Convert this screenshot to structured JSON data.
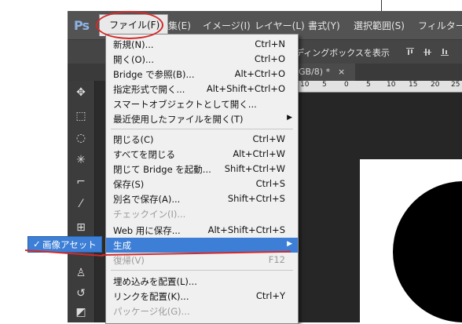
{
  "app": {
    "logo": "Ps",
    "menu": [
      {
        "label": "ファイル(F)"
      },
      {
        "label": "編集(E)"
      },
      {
        "label": "イメージ(I)"
      },
      {
        "label": "レイヤー(L)"
      },
      {
        "label": "書式(Y)"
      },
      {
        "label": "選択範囲(S)"
      },
      {
        "label": "フィルター(T"
      }
    ],
    "options_text": "ディングボックスを表示",
    "doc_tab": "GB/8) *",
    "doc_close": "×",
    "ruler_labels": [
      "10",
      "5",
      "0",
      "5",
      "10",
      "15",
      "20",
      "25"
    ]
  },
  "file_menu": {
    "items": [
      {
        "label": "新規(N)...",
        "shortcut": "Ctrl+N"
      },
      {
        "label": "開く(O)...",
        "shortcut": "Ctrl+O"
      },
      {
        "label": "Bridge で参照(B)...",
        "shortcut": "Alt+Ctrl+O"
      },
      {
        "label": "指定形式で開く...",
        "shortcut": "Alt+Shift+Ctrl+O"
      },
      {
        "label": "スマートオブジェクトとして開く...",
        "shortcut": ""
      },
      {
        "label": "最近使用したファイルを開く(T)",
        "shortcut": "",
        "submenu": true
      },
      {
        "label": "閉じる(C)",
        "shortcut": "Ctrl+W"
      },
      {
        "label": "すべてを閉じる",
        "shortcut": "Alt+Ctrl+W"
      },
      {
        "label": "閉じて Bridge を起動...",
        "shortcut": "Shift+Ctrl+W"
      },
      {
        "label": "保存(S)",
        "shortcut": "Ctrl+S"
      },
      {
        "label": "別名で保存(A)...",
        "shortcut": "Shift+Ctrl+S"
      },
      {
        "label": "チェックイン(I)...",
        "shortcut": "",
        "disabled": true
      },
      {
        "label": "Web 用に保存...",
        "shortcut": "Alt+Shift+Ctrl+S"
      },
      {
        "label": "生成",
        "shortcut": "",
        "submenu": true,
        "highlighted": true
      },
      {
        "label": "復帰(V)",
        "shortcut": "F12",
        "disabled": true
      },
      {
        "label": "埋め込みを配置(L)...",
        "shortcut": ""
      },
      {
        "label": "リンクを配置(K)...",
        "shortcut": "Ctrl+Y"
      },
      {
        "label": "パッケージ化(G)...",
        "shortcut": "",
        "disabled": true
      }
    ],
    "submenu_arrow": "▶"
  },
  "generate_submenu": {
    "check": "✓",
    "label": "画像アセット"
  },
  "colors": {
    "highlight": "#3d7fd6",
    "annotation": "#d42a2a",
    "menubar": "#535353"
  }
}
